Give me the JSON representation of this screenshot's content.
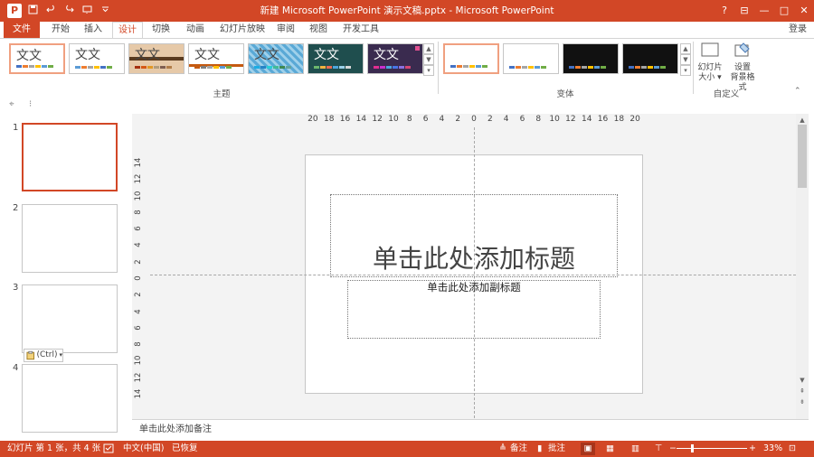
{
  "titlebar": {
    "title": "新建 Microsoft PowerPoint 演示文稿.pptx -  Microsoft PowerPoint",
    "app_icon": "P",
    "help": "?",
    "ribbon_display": "⊟",
    "minimize": "—",
    "restore": "□",
    "close": "✕"
  },
  "tabs": {
    "file": "文件",
    "items": [
      "开始",
      "插入",
      "设计",
      "切换",
      "动画",
      "幻灯片放映",
      "审阅",
      "视图",
      "开发工具"
    ],
    "login": "登录"
  },
  "ribbon": {
    "themes": [
      {
        "text": "文文",
        "bg": "#ffffff",
        "fg": "#222222"
      },
      {
        "text": "文文",
        "bg": "#ffffff",
        "fg": "#222222"
      },
      {
        "text": "文文",
        "bg": "#e6c9a8",
        "fg": "#222222"
      },
      {
        "text": "文文",
        "bg": "#ffffff",
        "fg": "#222222"
      },
      {
        "text": "文文",
        "bg": "#5aa9d6",
        "fg": "#222222"
      },
      {
        "text": "文文",
        "bg": "#1f4e4e",
        "fg": "#ffffff"
      },
      {
        "text": "文文",
        "bg": "#3a2b4f",
        "fg": "#ffffff"
      }
    ],
    "themes_label": "主题",
    "variants_label": "变体",
    "custom_label": "自定义",
    "slide_size": [
      "幻灯片",
      "大小 ▾"
    ],
    "format_bg": [
      "设置",
      "背景格式"
    ]
  },
  "slides": {
    "numbers": [
      "1",
      "2",
      "3",
      "4"
    ],
    "paste_label": "(Ctrl)"
  },
  "ruler": {
    "h": [
      "20",
      "18",
      "16",
      "14",
      "12",
      "10",
      "8",
      "6",
      "4",
      "2",
      "0",
      "2",
      "4",
      "6",
      "8",
      "10",
      "12",
      "14",
      "16",
      "18",
      "20"
    ],
    "v": [
      "14",
      "12",
      "10",
      "8",
      "6",
      "4",
      "2",
      "0",
      "2",
      "4",
      "6",
      "8",
      "10",
      "12",
      "14"
    ]
  },
  "editor": {
    "title_placeholder": "单击此处添加标题",
    "subtitle_placeholder": "单击此处添加副标题",
    "notes_placeholder": "单击此处添加备注"
  },
  "status": {
    "slide_info": "幻灯片 第 1 张，共 4 张",
    "language": "中文(中国)",
    "recovered": "已恢复",
    "notes": "备注",
    "comments": "批注",
    "zoom": "33%",
    "zoom_out": "−",
    "zoom_in": "+"
  },
  "colors": {
    "accent": "#d24726"
  }
}
